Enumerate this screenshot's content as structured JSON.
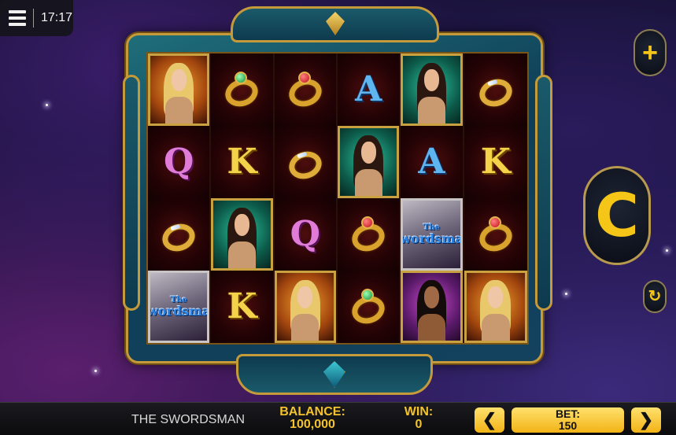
{
  "topbar": {
    "time": "17:17"
  },
  "reels": [
    [
      {
        "type": "portrait",
        "variant": "blonde",
        "frame": "orange"
      },
      {
        "type": "letter",
        "value": "Q"
      },
      {
        "type": "ring",
        "gem": "diamond"
      },
      {
        "type": "swordsman",
        "the": "The",
        "name": "Swordsman"
      }
    ],
    [
      {
        "type": "ring",
        "gem": "emerald"
      },
      {
        "type": "letter",
        "value": "K"
      },
      {
        "type": "portrait",
        "variant": "dark",
        "frame": "teal"
      },
      {
        "type": "letter",
        "value": "K"
      }
    ],
    [
      {
        "type": "ring",
        "gem": "ruby"
      },
      {
        "type": "ring",
        "gem": "diamond"
      },
      {
        "type": "letter",
        "value": "Q"
      },
      {
        "type": "portrait",
        "variant": "blonde",
        "frame": "orange"
      }
    ],
    [
      {
        "type": "letter",
        "value": "A"
      },
      {
        "type": "portrait",
        "variant": "dark",
        "frame": "teal"
      },
      {
        "type": "ring",
        "gem": "ruby"
      },
      {
        "type": "ring",
        "gem": "emerald"
      }
    ],
    [
      {
        "type": "portrait",
        "variant": "dark",
        "frame": "teal"
      },
      {
        "type": "letter",
        "value": "A"
      },
      {
        "type": "swordsman",
        "the": "The",
        "name": "Swordsman"
      },
      {
        "type": "portrait",
        "variant": "black",
        "frame": "pink"
      }
    ],
    [
      {
        "type": "ring",
        "gem": "diamond"
      },
      {
        "type": "letter",
        "value": "K"
      },
      {
        "type": "ring",
        "gem": "ruby"
      },
      {
        "type": "portrait",
        "variant": "blonde",
        "frame": "orange"
      }
    ]
  ],
  "controls": {
    "plus_icon": "+",
    "spin_icon": "C",
    "autoplay_icon": "↻"
  },
  "bottom": {
    "game_name": "THE SWORDSMAN",
    "balance_label": "BALANCE:",
    "balance_value": "100,000",
    "win_label": "WIN:",
    "win_value": "0",
    "bet_label": "BET:",
    "bet_value": "150",
    "bet_decrease_icon": "❮",
    "bet_increase_icon": "❯"
  },
  "colors": {
    "accent": "#f5c518",
    "frame_gold": "#c49a3b",
    "frame_teal": "#0f3e57"
  }
}
